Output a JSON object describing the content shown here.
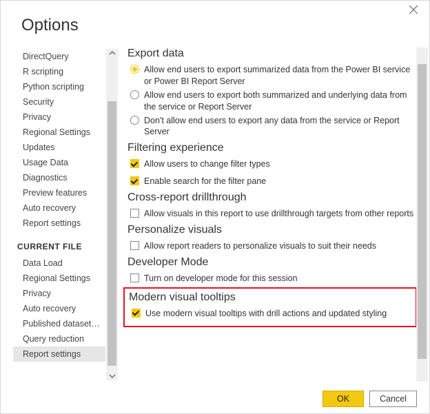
{
  "window": {
    "title": "Options"
  },
  "nav": {
    "global_items": [
      "DirectQuery",
      "R scripting",
      "Python scripting",
      "Security",
      "Privacy",
      "Regional Settings",
      "Updates",
      "Usage Data",
      "Diagnostics",
      "Preview features",
      "Auto recovery",
      "Report settings"
    ],
    "section_header": "CURRENT FILE",
    "file_items": [
      "Data Load",
      "Regional Settings",
      "Privacy",
      "Auto recovery",
      "Published dataset set...",
      "Query reduction",
      "Report settings"
    ],
    "selected_index_file": 6
  },
  "content": {
    "export": {
      "title": "Export data",
      "options": [
        "Allow end users to export summarized data from the Power BI service or Power BI Report Server",
        "Allow end users to export both summarized and underlying data from the service or Report Server",
        "Don't allow end users to export any data from the service or Report Server"
      ],
      "selected": 0
    },
    "filtering": {
      "title": "Filtering experience",
      "options": [
        "Allow users to change filter types",
        "Enable search for the filter pane"
      ],
      "checked": [
        true,
        true
      ]
    },
    "crossreport": {
      "title": "Cross-report drillthrough",
      "option": "Allow visuals in this report to use drillthrough targets from other reports",
      "checked": false
    },
    "personalize": {
      "title": "Personalize visuals",
      "option": "Allow report readers to personalize visuals to suit their needs",
      "checked": false
    },
    "developer": {
      "title": "Developer Mode",
      "option": "Turn on developer mode for this session",
      "checked": false
    },
    "tooltips": {
      "title": "Modern visual tooltips",
      "option": "Use modern visual tooltips with drill actions and updated styling",
      "checked": true
    }
  },
  "footer": {
    "ok": "OK",
    "cancel": "Cancel"
  },
  "colors": {
    "accent": "#f2c811",
    "highlight_border": "#e81123"
  }
}
